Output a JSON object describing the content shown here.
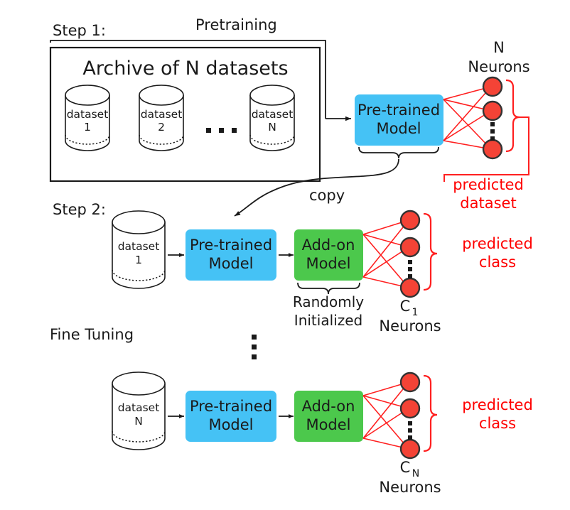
{
  "diagram": {
    "title_step1": "Step 1:",
    "title_step2": "Step 2:",
    "pretraining_label": "Pretraining",
    "fine_tuning_label": "Fine Tuning",
    "archive_label": "Archive of N datasets",
    "copy_label": "copy",
    "randomly_initialized_line1": "Randomly",
    "randomly_initialized_line2": "Initialized",
    "ellipsis_horizontal": "...",
    "ellipsis_vertical": "⋮",
    "colors": {
      "pretrained_box": "#45c2f5",
      "addon_box": "#4cc84c",
      "neuron": "#f44336",
      "neuron_stroke": "#333333",
      "red_text": "#ff0000",
      "line": "#1a1a1a",
      "red_line": "#ff2020"
    },
    "archive_datasets": [
      {
        "name": "dataset",
        "index": "1"
      },
      {
        "name": "dataset",
        "index": "2"
      },
      {
        "name": "dataset",
        "index": "N"
      }
    ],
    "step1": {
      "model_line1": "Pre-trained",
      "model_line2": "Model",
      "neurons_label_line1": "N",
      "neurons_label_line2": "Neurons",
      "output_label_line1": "predicted",
      "output_label_line2": "dataset",
      "neuron_count_shown": 3
    },
    "step2_rows": [
      {
        "dataset_name": "dataset",
        "dataset_index": "1",
        "pretrained_line1": "Pre-trained",
        "pretrained_line2": "Model",
        "addon_line1": "Add-on",
        "addon_line2": "Model",
        "neurons_label_main": "C",
        "neurons_label_sub": "1",
        "neurons_label_line2": "Neurons",
        "output_label_line1": "predicted",
        "output_label_line2": "class",
        "neuron_count_shown": 3
      },
      {
        "dataset_name": "dataset",
        "dataset_index": "N",
        "pretrained_line1": "Pre-trained",
        "pretrained_line2": "Model",
        "addon_line1": "Add-on",
        "addon_line2": "Model",
        "neurons_label_main": "C",
        "neurons_label_sub": "N",
        "neurons_label_line2": "Neurons",
        "output_label_line1": "predicted",
        "output_label_line2": "class",
        "neuron_count_shown": 3
      }
    ]
  }
}
